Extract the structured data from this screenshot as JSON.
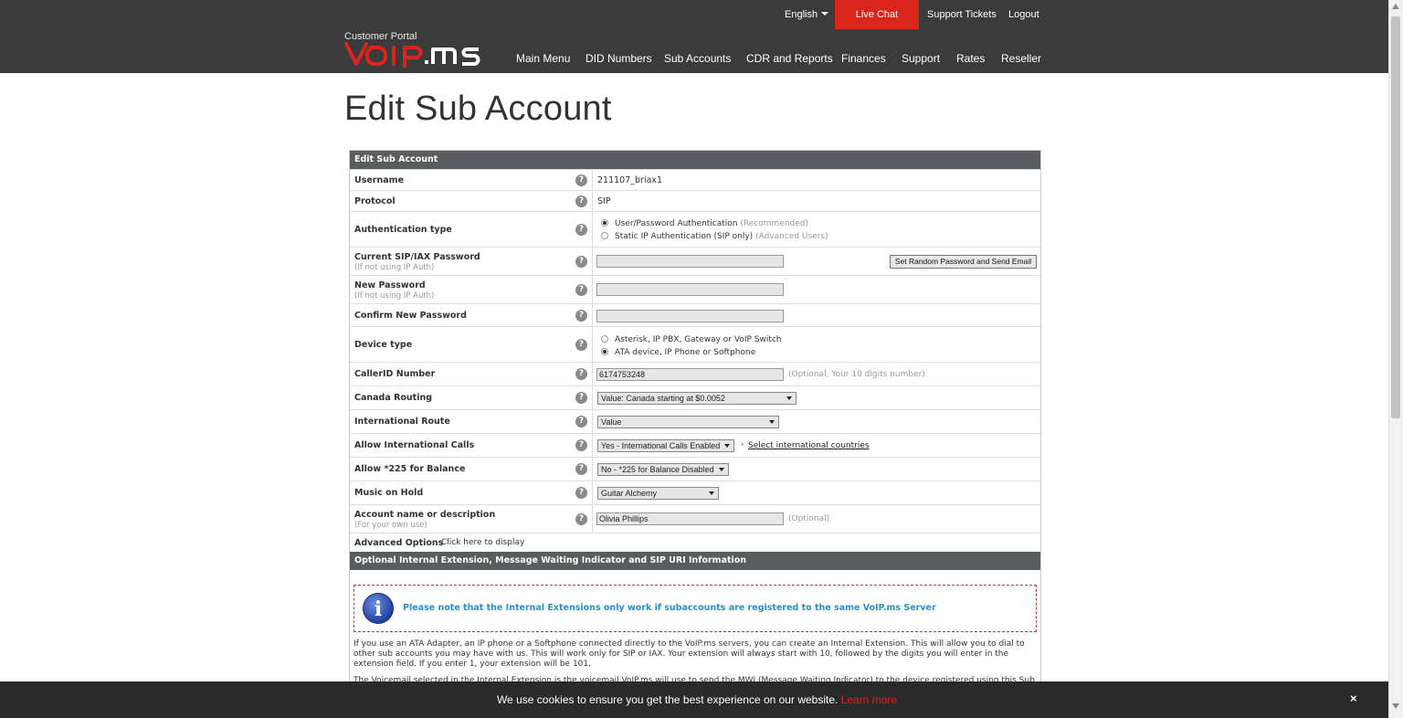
{
  "header": {
    "portal_label": "Customer Portal",
    "language": "English",
    "live_chat": "Live Chat",
    "support_tickets": "Support Tickets",
    "logout": "Logout",
    "brand_accent": "#d9261c",
    "nav": [
      "Main Menu",
      "DID Numbers",
      "Sub Accounts",
      "CDR and Reports",
      "Finances",
      "Support",
      "Rates",
      "Reseller"
    ]
  },
  "page": {
    "title": "Edit Sub Account"
  },
  "form": {
    "section_title": "Edit Sub Account",
    "help_glyph": "?",
    "username": {
      "label": "Username",
      "value": "211107_briax1"
    },
    "protocol": {
      "label": "Protocol",
      "value": "SIP"
    },
    "auth_type": {
      "label": "Authentication type",
      "opt1": "User/Password Authentication",
      "opt1_note": "(Recommended)",
      "opt2": "Static IP Authentication (SIP only)",
      "opt2_note": "(Advanced Users)"
    },
    "current_password": {
      "label": "Current SIP/IAX Password",
      "sub": "(If not using IP Auth)",
      "value": "",
      "button": "Set Random Password and Send Email"
    },
    "new_password": {
      "label": "New Password",
      "sub": "(If not using IP Auth)",
      "value": ""
    },
    "confirm_password": {
      "label": "Confirm New Password",
      "value": ""
    },
    "device_type": {
      "label": "Device type",
      "opt1": "Asterisk, IP PBX, Gateway or VoIP Switch",
      "opt2": "ATA device, IP Phone or Softphone"
    },
    "callerid": {
      "label": "CallerID Number",
      "value": "6174753248",
      "hint": "(Optional, Your 10 digits number)"
    },
    "canada_routing": {
      "label": "Canada Routing",
      "value": "Value: Canada starting at $0.0052"
    },
    "international_route": {
      "label": "International Route",
      "value": "Value"
    },
    "allow_international": {
      "label": "Allow International Calls",
      "value": "Yes - International Calls Enabled",
      "arrow": "›",
      "link": "Select international countries"
    },
    "allow_225": {
      "label": "Allow *225 for Balance",
      "value": "No - *225 for Balance Disabled"
    },
    "music_on_hold": {
      "label": "Music on Hold",
      "value": "Guitar Alchemy"
    },
    "account_name": {
      "label": "Account name or description",
      "sub": "(For your own use)",
      "value": "Olivia Phillips",
      "hint": "(Optional)"
    },
    "advanced": {
      "label": "Advanced Options",
      "link": "Click here to display"
    },
    "section2_title": "Optional Internal Extension, Message Waiting Indicator and SIP URI Information",
    "notice": "Please note that the Internal Extensions only work if subaccounts are registered to the same VoIP.ms Server",
    "info_glyph": "i",
    "para1": "If you use an ATA Adapter, an IP phone or a Softphone connected directly to the VoIP.ms servers, you can create an Internal Extension. This will allow you to dial to other sub accounts you may have with us. This will work only for SIP or IAX. Your extension will always start with 10, followed by the digits you will enter in the extension field. If you enter 1, your extension will be 101.",
    "para2": "The Voicemail selected in the Internal Extension is the voicemail VoIP.ms will use to send the MWI (Message Waiting Indicator) to the device registered using this Sub"
  },
  "cookie": {
    "text": "We use cookies to ensure you get the best experience on our website.",
    "link": "Learn more",
    "close": "×"
  }
}
